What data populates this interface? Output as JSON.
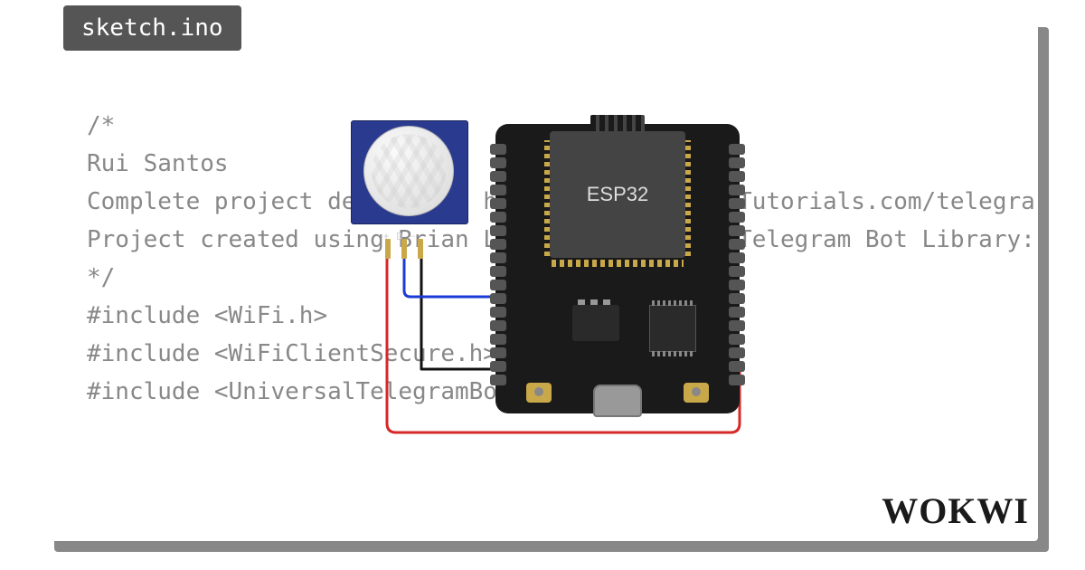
{
  "tab": {
    "filename": "sketch.ino"
  },
  "code": {
    "lines": [
      "/*",
      "  Rui Santos",
      "  Complete project details at https://RandomNerdTutorials.com/telegra",
      "",
      "  Project created using Brian Lough's Universal Telegram Bot Library: ht",
      "*/",
      "",
      "",
      "#include <WiFi.h>",
      "#include <WiFiClientSecure.h>",
      "#include <UniversalTelegramBot.h>"
    ]
  },
  "components": {
    "pir": {
      "name": "PIR Motion Sensor",
      "pins": [
        "+",
        "D",
        "−"
      ]
    },
    "esp32": {
      "name": "ESP32",
      "label": "ESP32"
    }
  },
  "wires": [
    {
      "name": "vcc",
      "color": "#d62828",
      "from": "pir.+",
      "to": "esp32.3V3"
    },
    {
      "name": "gnd",
      "color": "#111",
      "from": "pir.-",
      "to": "esp32.GND"
    },
    {
      "name": "signal",
      "color": "#1a3bd6",
      "from": "pir.D",
      "to": "esp32.D27"
    }
  ],
  "brand": "WOKWI"
}
